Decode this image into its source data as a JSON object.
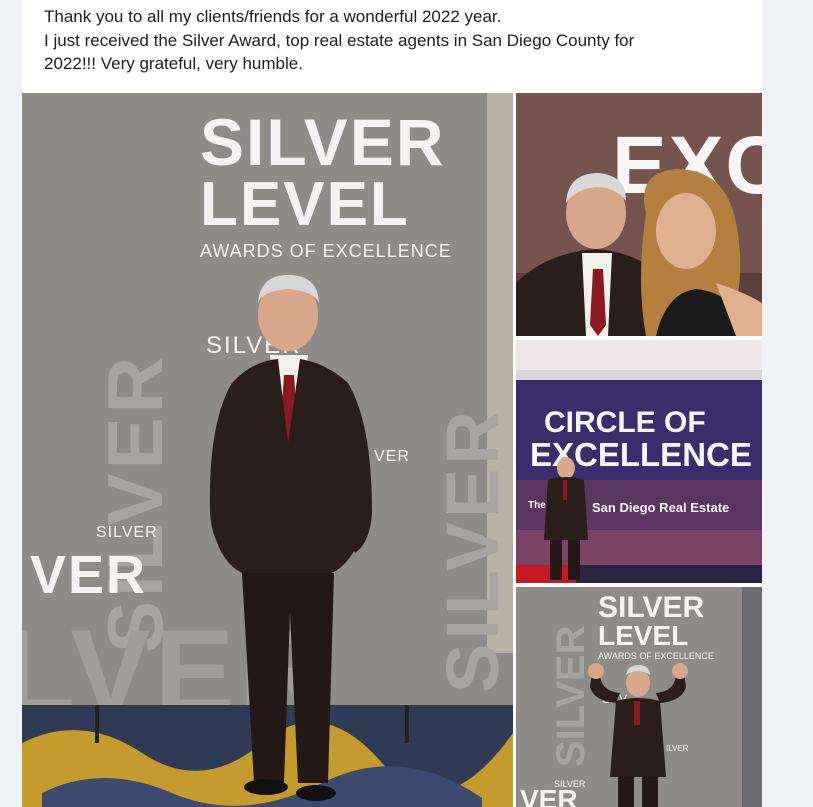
{
  "post": {
    "text_lines": [
      "Thank you to all my clients/friends for a wonderful 2022 year.",
      "I just received the Silver Award, top real estate agents in San Diego County for",
      "2022!!! Very grateful, very humble."
    ]
  },
  "photos": {
    "main": {
      "sign_title_1": "SILVER",
      "sign_title_2": "LEVEL",
      "sign_subtitle": "AWARDS OF EXCELLENCE",
      "backdrop_word": "SILVER",
      "backdrop_small_1": "SILVER",
      "backdrop_small_2": "SILVER",
      "backdrop_big_1": "VER",
      "backdrop_big_2": "LVER",
      "backdrop_fragment": "VER"
    },
    "top_right": {
      "wall_text": "EXC"
    },
    "middle_right": {
      "line_1": "CIRCLE OF",
      "line_2": "EXCELLENCE",
      "caption": "San Diego Real Estate",
      "caption_prefix": "The"
    },
    "bottom_right": {
      "sign_title_1": "SILVER",
      "sign_title_2": "LEVEL",
      "sign_subtitle": "AWARDS OF EXCELLENCE",
      "backdrop_word": "SILVER",
      "backdrop_small": "SILVER",
      "backdrop_big": "VER",
      "backdrop_fragment": "SILV",
      "backdrop_fragment_2": "ILVER"
    }
  },
  "colors": {
    "backdrop_gray": "#8f8c88",
    "sign_white": "#f4f3f1",
    "suit": "#2a1e1a",
    "tie": "#8b1a1e",
    "carpet_gold": "#c69b2d",
    "carpet_blue": "#3b4a6e",
    "purple_wall": "#3a2d6b"
  }
}
